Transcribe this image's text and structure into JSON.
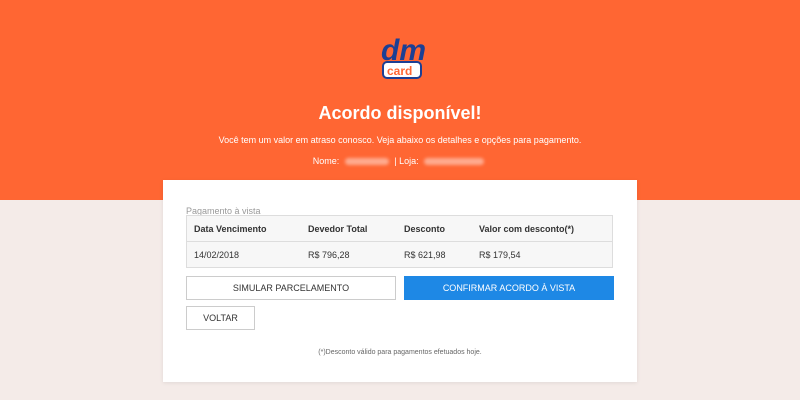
{
  "brand": {
    "logo_text_top": "dm",
    "logo_text_bottom": "card",
    "primary_color": "#ff6633",
    "logo_blue": "#1c3f94"
  },
  "hero": {
    "title": "Acordo disponível!",
    "subtitle": "Você tem um valor em atraso conosco. Veja abaixo os detalhes e opções para pagamento.",
    "name_label": "Nome:",
    "store_label": "Loja:",
    "separator": "|"
  },
  "payment": {
    "section_label": "Pagamento à vista",
    "columns": [
      "Data Vencimento",
      "Devedor Total",
      "Desconto",
      "Valor com desconto(*)"
    ],
    "row": [
      "14/02/2018",
      "R$ 796,28",
      "R$ 621,98",
      "R$ 179,54"
    ]
  },
  "actions": {
    "simulate": "SIMULAR PARCELAMENTO",
    "confirm": "CONFIRMAR ACORDO À VISTA",
    "back": "VOLTAR",
    "confirm_color": "#1e88e5"
  },
  "footnote": "(*)Desconto válido para pagamentos efetuados hoje."
}
